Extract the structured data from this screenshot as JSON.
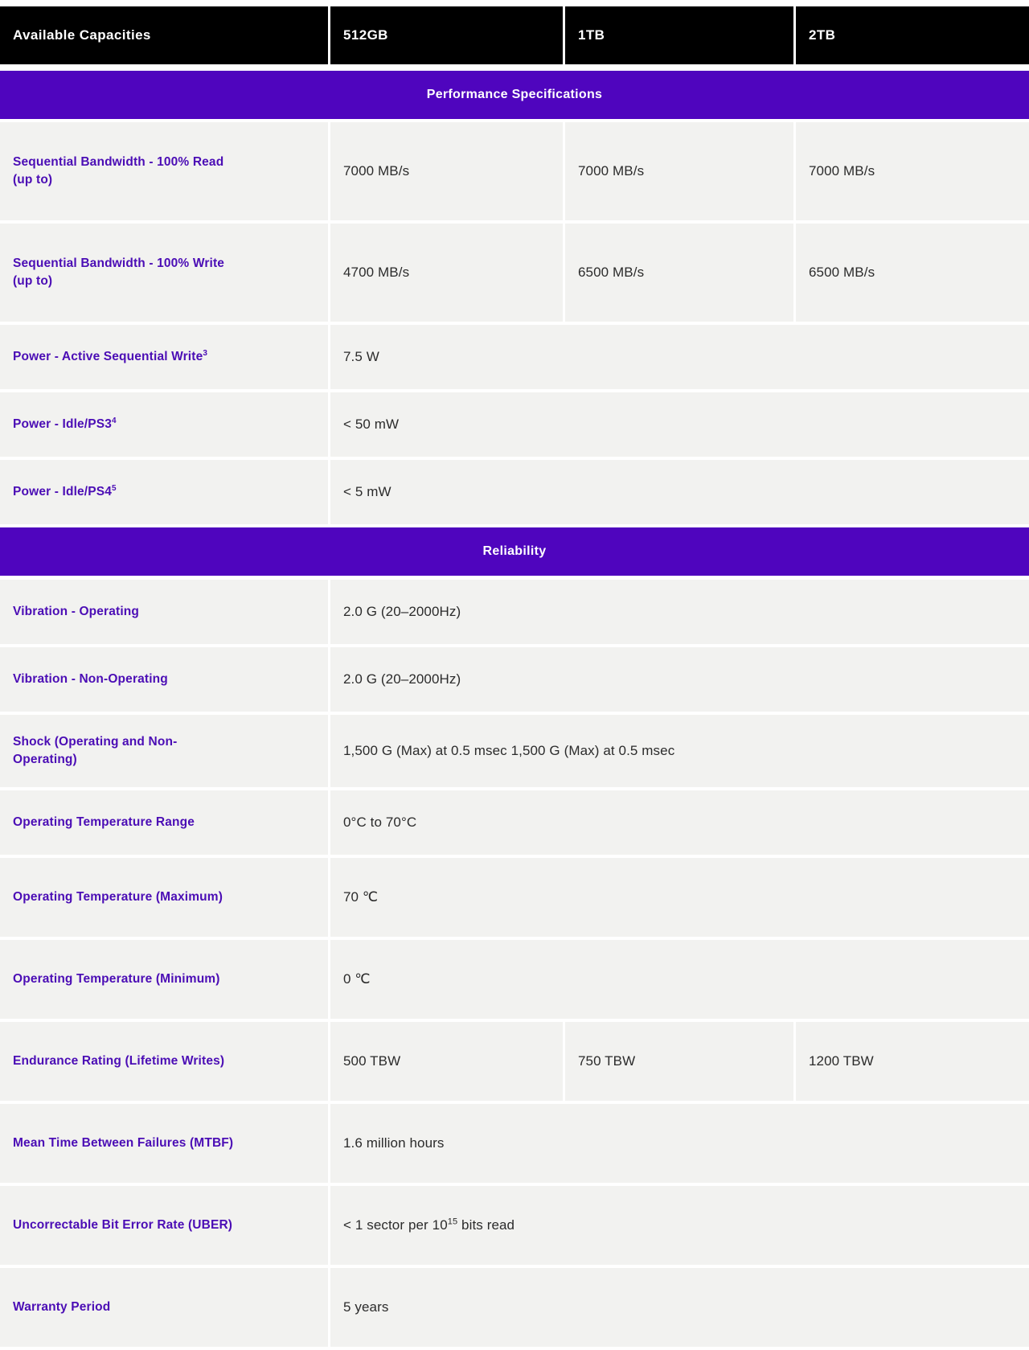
{
  "table": {
    "header": {
      "label": "Available Capacities",
      "capacities": [
        "512GB",
        "1TB",
        "2TB"
      ]
    },
    "sections": [
      {
        "title": "Performance Specifications",
        "rows": [
          {
            "label": "Sequential Bandwidth - 100% Read (up to)",
            "label_line1": "Sequential Bandwidth - 100% Read",
            "label_line2": "(up to)",
            "values": [
              "7000 MB/s",
              "7000 MB/s",
              "7000 MB/s"
            ],
            "span": false
          },
          {
            "label": "Sequential Bandwidth - 100% Write (up to)",
            "label_line1": "Sequential Bandwidth - 100% Write",
            "label_line2": "(up to)",
            "values": [
              "4700 MB/s",
              "6500 MB/s",
              "6500 MB/s"
            ],
            "span": false
          },
          {
            "label": "Power - Active Sequential Write",
            "footnote": "3",
            "values": [
              "7.5 W"
            ],
            "span": true
          },
          {
            "label": "Power - Idle/PS3",
            "footnote": "4",
            "values": [
              "< 50 mW"
            ],
            "span": true
          },
          {
            "label": "Power - Idle/PS4",
            "footnote": "5",
            "values": [
              "< 5 mW"
            ],
            "span": true
          }
        ]
      },
      {
        "title": "Reliability",
        "rows": [
          {
            "label": "Vibration - Operating",
            "values": [
              "2.0 G (20–2000Hz)"
            ],
            "span": true
          },
          {
            "label": "Vibration - Non-Operating",
            "values": [
              "2.0 G (20–2000Hz)"
            ],
            "span": true
          },
          {
            "label": "Shock (Operating and Non-Operating)",
            "label_line1": "Shock (Operating and Non-",
            "label_line2": "Operating)",
            "values": [
              "1,500 G (Max) at 0.5 msec 1,500 G (Max) at 0.5 msec"
            ],
            "span": true
          },
          {
            "label": "Operating Temperature Range",
            "values": [
              "0°C to 70°C"
            ],
            "span": true
          },
          {
            "label": "Operating Temperature (Maximum)",
            "values": [
              "70 ℃"
            ],
            "span": true
          },
          {
            "label": "Operating Temperature (Minimum)",
            "values": [
              "0 ℃"
            ],
            "span": true
          },
          {
            "label": "Endurance Rating (Lifetime Writes)",
            "values": [
              "500 TBW",
              "750 TBW",
              "1200 TBW"
            ],
            "span": false
          },
          {
            "label": "Mean Time Between Failures (MTBF)",
            "values": [
              "1.6 million hours"
            ],
            "span": true
          },
          {
            "label": "Uncorrectable Bit Error Rate (UBER)",
            "value_pre": "< 1 sector per 10",
            "value_sup": "15",
            "value_post": " bits read",
            "values": [
              "< 1 sector per 10¹⁵ bits read"
            ],
            "span": true
          },
          {
            "label": "Warranty Period",
            "values": [
              "5 years"
            ],
            "span": true
          }
        ]
      }
    ]
  },
  "colors": {
    "accent_purple": "#4F05BE",
    "label_purple": "#4B0DB5",
    "header_black": "#000000",
    "row_background": "#f2f2f0",
    "value_text": "#2b2b2b"
  }
}
